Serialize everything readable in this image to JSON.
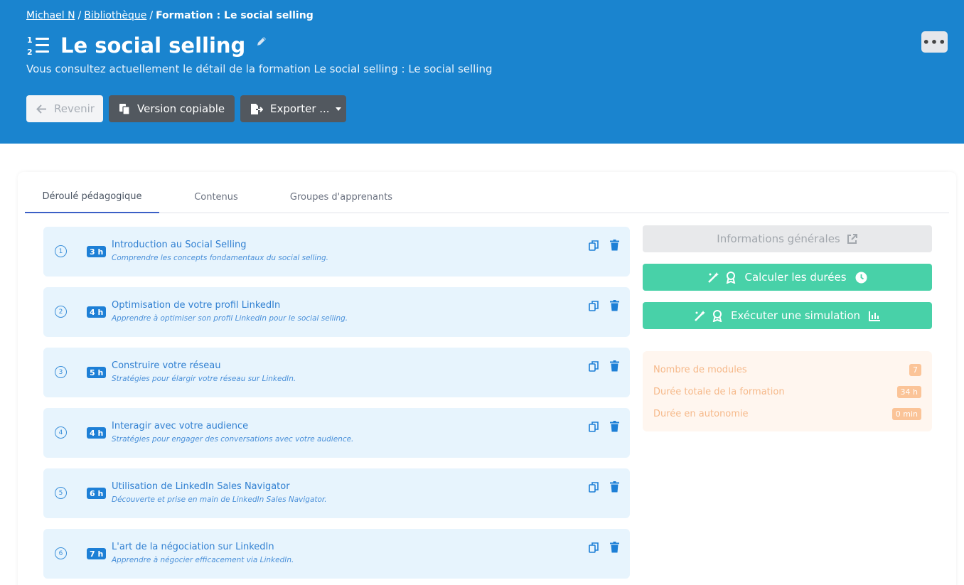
{
  "breadcrumb": {
    "items": [
      "Michael N",
      "Bibliothèque"
    ],
    "separator": "/",
    "current": "Formation : Le social selling"
  },
  "header": {
    "title": "Le social selling",
    "subtitle": "Vous consultez actuellement le détail de la formation Le social selling : Le social selling",
    "more_label": "•••",
    "background_color": "#1a84cf"
  },
  "actions": {
    "back_label": "Revenir",
    "copy_label": "Version copiable",
    "export_label": "Exporter ..."
  },
  "tabs": [
    {
      "label": "Déroulé pédagogique",
      "active": true
    },
    {
      "label": "Contenus",
      "active": false
    },
    {
      "label": "Groupes d'apprenants",
      "active": false
    }
  ],
  "modules": [
    {
      "number": "1",
      "duration": "3 h",
      "title": "Introduction au Social Selling",
      "description": "Comprendre les concepts fondamentaux du social selling."
    },
    {
      "number": "2",
      "duration": "4 h",
      "title": "Optimisation de votre profil LinkedIn",
      "description": "Apprendre à optimiser son profil LinkedIn pour le social selling."
    },
    {
      "number": "3",
      "duration": "5 h",
      "title": "Construire votre réseau",
      "description": "Stratégies pour élargir votre réseau sur LinkedIn."
    },
    {
      "number": "4",
      "duration": "4 h",
      "title": "Interagir avec votre audience",
      "description": "Stratégies pour engager des conversations avec votre audience."
    },
    {
      "number": "5",
      "duration": "6 h",
      "title": "Utilisation de LinkedIn Sales Navigator",
      "description": "Découverte et prise en main de LinkedIn Sales Navigator."
    },
    {
      "number": "6",
      "duration": "7 h",
      "title": "L'art de la négociation sur LinkedIn",
      "description": "Apprendre à négocier efficacement via LinkedIn."
    }
  ],
  "sidebar": {
    "info_label": "Informations générales",
    "calc_label": "Calculer les durées",
    "sim_label": "Exécuter une simulation",
    "accent_color": "#48d1a8"
  },
  "stats": [
    {
      "label": "Nombre de modules",
      "value": "7"
    },
    {
      "label": "Durée totale de la formation",
      "value": "34 h"
    },
    {
      "label": "Durée en autonomie",
      "value": "0 min"
    }
  ]
}
